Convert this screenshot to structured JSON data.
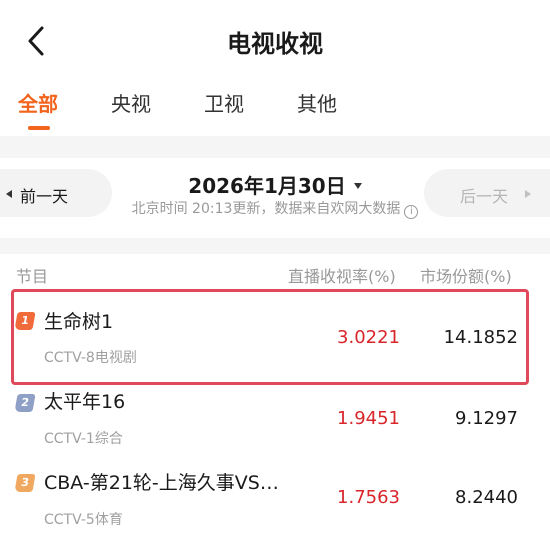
{
  "header": {
    "title": "电视收视"
  },
  "tabs": [
    {
      "label": "全部",
      "active": true
    },
    {
      "label": "央视",
      "active": false
    },
    {
      "label": "卫视",
      "active": false
    },
    {
      "label": "其他",
      "active": false
    }
  ],
  "datebar": {
    "prev_label": "前一天",
    "next_label": "后一天",
    "date": "2026年1月30日",
    "update_text": "北京时间 20:13更新，数据来自欢网大数据",
    "info_glyph": "i"
  },
  "table": {
    "headers": {
      "program": "节目",
      "rating": "直播收视率(%)",
      "share": "市场份额(%)"
    },
    "rows": [
      {
        "rank": "1",
        "name": "生命树1",
        "channel": "CCTV-8电视剧",
        "rating": "3.0221",
        "share": "14.1852",
        "rank_color": "#f06a3a"
      },
      {
        "rank": "2",
        "name": "太平年16",
        "channel": "CCTV-1综合",
        "rating": "1.9451",
        "share": "9.1297",
        "rank_color": "#8fa0c7"
      },
      {
        "rank": "3",
        "name": "CBA-第21轮-上海久事VS…",
        "channel": "CCTV-5体育",
        "rating": "1.7563",
        "share": "8.2440",
        "rank_color": "#f0a860"
      }
    ]
  },
  "colors": {
    "accent": "#f2641c",
    "rating": "#d8262b",
    "highlight": "#e0495a"
  }
}
